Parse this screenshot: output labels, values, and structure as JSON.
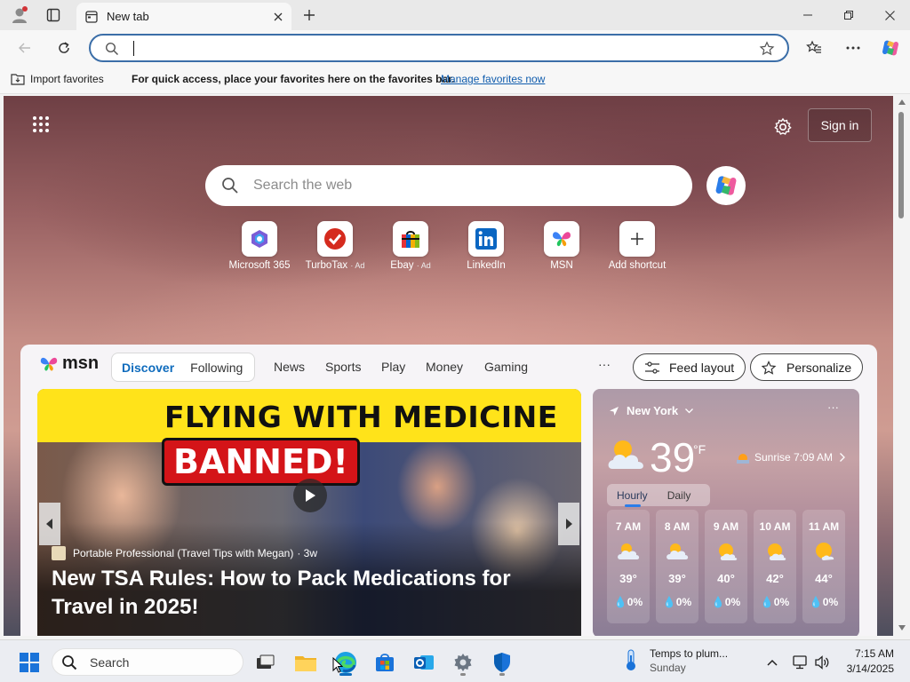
{
  "browser": {
    "tab_title": "New tab",
    "address_value": "",
    "favorites_bar": {
      "import_label": "Import favorites",
      "hint": "For quick access, place your favorites here on the favorites bar.",
      "manage_link": "Manage favorites now"
    }
  },
  "ntp": {
    "search_placeholder": "Search the web",
    "sign_in": "Sign in",
    "shortcuts": [
      {
        "label": "Microsoft 365",
        "ad": ""
      },
      {
        "label": "TurboTax",
        "ad": "· Ad"
      },
      {
        "label": "Ebay",
        "ad": "· Ad"
      },
      {
        "label": "LinkedIn",
        "ad": ""
      },
      {
        "label": "MSN",
        "ad": ""
      },
      {
        "label": "Add shortcut",
        "ad": ""
      }
    ]
  },
  "msn": {
    "logo": "msn",
    "tabs": {
      "discover": "Discover",
      "following": "Following"
    },
    "nav": [
      "News",
      "Sports",
      "Play",
      "Money",
      "Gaming"
    ],
    "more": "···",
    "feed_layout": "Feed layout",
    "personalize": "Personalize",
    "hero": {
      "banner_line1": "FLYING WITH MEDICINE",
      "banner_line2": "BANNED!",
      "source": "Portable Professional (Travel Tips with Megan)",
      "age": "· 3w",
      "headline": "New TSA Rules: How to Pack Medications for Travel in 2025!"
    },
    "weather": {
      "location": "New York",
      "temp": "39",
      "unit": "°F",
      "sunrise": "Sunrise 7:09 AM",
      "tab_hourly": "Hourly",
      "tab_daily": "Daily",
      "more": "···",
      "hours": [
        {
          "time": "7 AM",
          "temp": "39°",
          "precip": "0%",
          "icon": "partly-cloudy-icon"
        },
        {
          "time": "8 AM",
          "temp": "39°",
          "precip": "0%",
          "icon": "partly-cloudy-icon"
        },
        {
          "time": "9 AM",
          "temp": "40°",
          "precip": "0%",
          "icon": "partly-sunny-icon"
        },
        {
          "time": "10 AM",
          "temp": "42°",
          "precip": "0%",
          "icon": "partly-sunny-icon"
        },
        {
          "time": "11 AM",
          "temp": "44°",
          "precip": "0%",
          "icon": "sunny-cloud-icon"
        }
      ]
    }
  },
  "taskbar": {
    "search_label": "Search",
    "news_title": "Temps to plum...",
    "news_sub": "Sunday",
    "time": "7:15 AM",
    "date": "3/14/2025"
  },
  "colors": {
    "accent": "#0f6cbd",
    "omnibox_border": "#3b6ea8",
    "banner_yellow": "#ffe31a",
    "banned_red": "#d41418"
  }
}
